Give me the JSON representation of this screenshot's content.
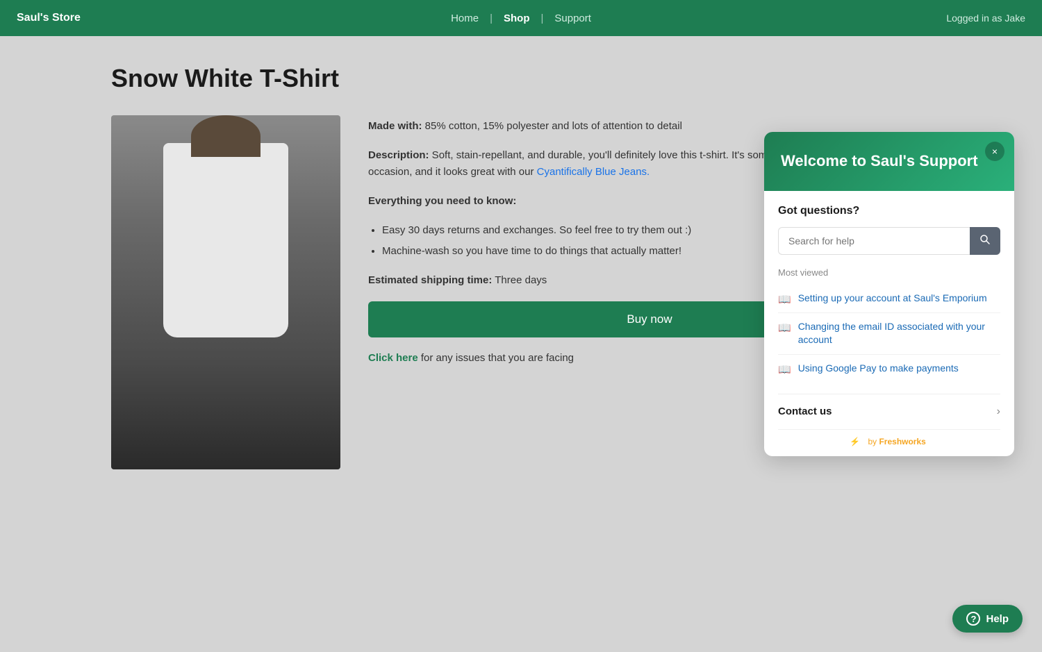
{
  "navbar": {
    "brand": "Saul's Store",
    "nav_home": "Home",
    "nav_shop": "Shop",
    "nav_support": "Support",
    "sep": "|",
    "logged_in": "Logged in as Jake"
  },
  "product": {
    "title": "Snow White T-Shirt",
    "made_with_label": "Made with:",
    "made_with_value": " 85% cotton, 15% polyester and lots of attention to detail",
    "description_label": "Description:",
    "description_value": " Soft, stain-repellant, and durable, you'll definitely love this t-shirt. It's something you can wear for any occasion, and it looks great with our ",
    "blue_link": "Cyantifically Blue Jeans.",
    "everything_label": "Everything you need to know:",
    "bullet1": "Easy 30 days returns and exchanges. So feel free to try them out :)",
    "bullet2": "Machine-wash so you have time to do things that actually matter!",
    "shipping_label": "Estimated shipping time:",
    "shipping_value": " Three days",
    "buy_now": "Buy now",
    "click_here": "Click here",
    "click_here_suffix": " for any issues that you are facing"
  },
  "support_widget": {
    "header_title": "Welcome to Saul's Support",
    "close_label": "×",
    "got_questions": "Got questions?",
    "search_placeholder": "Search for help",
    "search_icon": "🔍",
    "most_viewed_label": "Most viewed",
    "articles": [
      {
        "title": "Setting up your account at Saul's Emporium"
      },
      {
        "title": "Changing the email ID associated with your account"
      },
      {
        "title": "Using Google Pay to make payments"
      }
    ],
    "contact_us": "Contact us",
    "footer_by": "by Freshworks",
    "footer_lightning": "⚡"
  },
  "help_button": {
    "label": "Help"
  }
}
